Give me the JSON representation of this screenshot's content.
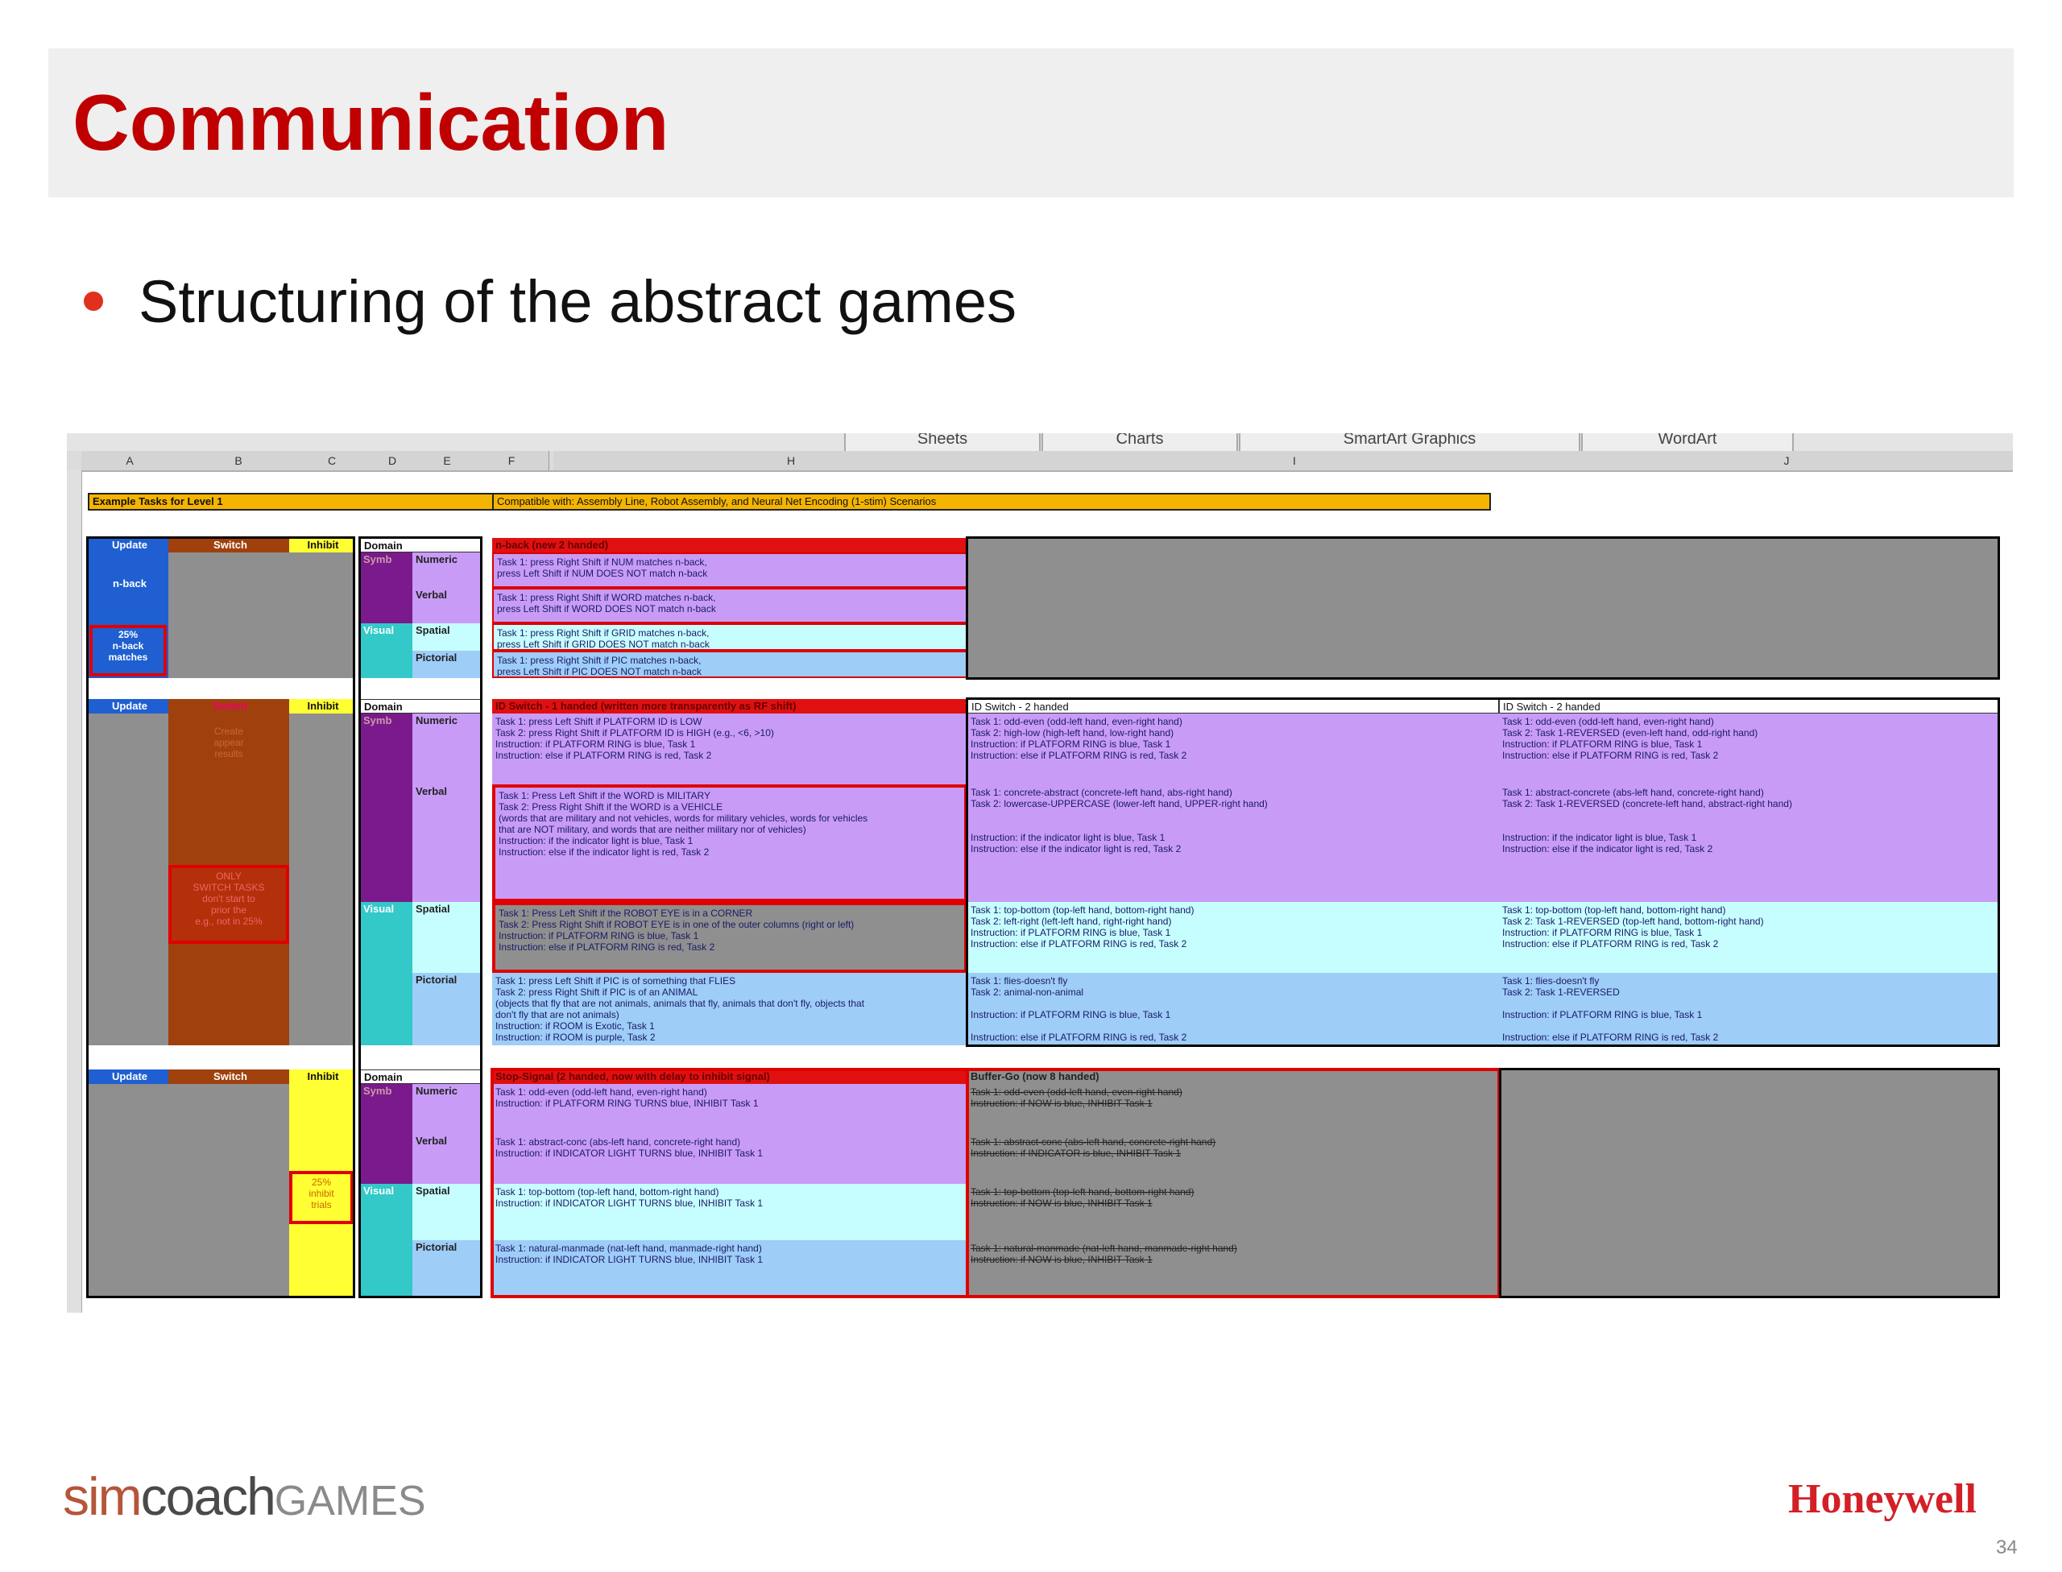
{
  "slide": {
    "title": "Communication",
    "bullet": "Structuring of the abstract games",
    "page_number": "34"
  },
  "logos": {
    "left": {
      "sim": "sim",
      "coach": "coach",
      "games": "GAMES"
    },
    "right": "Honeywell"
  },
  "sheet": {
    "ribbon_tabs": [
      "Sheets",
      "Charts",
      "SmartArt Graphics",
      "WordArt"
    ],
    "columns": [
      "A",
      "B",
      "C",
      "D",
      "E",
      "F",
      "H",
      "I",
      "J"
    ],
    "left_header": "Example Tasks for Level 1",
    "right_header": "Compatible with: Assembly Line, Robot Assembly, and Neural Net Encoding (1-stim) Scenarios",
    "col_labels": {
      "update": "Update",
      "switch": "Switch",
      "inhibit": "Inhibit",
      "domain": "Domain"
    },
    "domains": {
      "verbal_group": "Symb",
      "visual_group": "Visual",
      "numeric": "Numeric",
      "verbal": "Verbal",
      "spatial": "Spatial",
      "pictorial": "Pictorial"
    },
    "block1": {
      "update_label": "n-back",
      "update_note": "25%\nn-back\nmatches",
      "title": "n-back (new 2 handed)",
      "rows": [
        "Task 1: press Right Shift if NUM matches n-back,\n      press Left Shift if NUM DOES NOT match n-back",
        "Task 1: press Right Shift if WORD matches n-back,\n      press Left Shift if WORD DOES NOT match n-back",
        "Task 1: press Right Shift if GRID matches n-back,\n      press Left Shift if GRID DOES NOT match n-back",
        "Task 1: press Right Shift if PIC matches n-back,\n      press Left Shift if PIC DOES NOT match n-back"
      ]
    },
    "block2": {
      "switch_note": "Create\nappear\nresults",
      "switch_note2": "ONLY\nSWITCH TASKS\ndon't start to\nprior the\ne.g., not in 25%",
      "title": "ID Switch - 1 handed (written more transparently as RF shift)",
      "title_mid": "ID Switch - 2 handed",
      "title_right": "ID Switch - 2 handed",
      "rows_left": [
        "Task 1: press Left Shift if PLATFORM ID is LOW\nTask 2: press Right Shift if PLATFORM ID is HIGH        (e.g., <6, >10)\nInstruction: if PLATFORM RING is blue, Task 1\nInstruction: else if PLATFORM RING is red, Task 2",
        "Task 1: Press Left Shift if the WORD is MILITARY\nTask 2: Press Right Shift if the WORD is a VEHICLE\n(words that are military and not vehicles, words for military vehicles, words for vehicles\nthat are NOT military, and words that are neither military nor of vehicles)\nInstruction: if the indicator light is blue, Task 1\nInstruction: else if the indicator light is red, Task 2",
        "Task 1: Press Left Shift if the ROBOT EYE is in a CORNER\nTask 2: Press Right Shift if ROBOT EYE is in one of the outer columns (right or left)\nInstruction: if PLATFORM RING is blue, Task 1\nInstruction: else if PLATFORM RING is red, Task 2",
        "Task 1: press Left Shift if PIC is of something that FLIES\nTask 2: press Right Shift if PIC is of an ANIMAL\n(objects that fly that are not animals, animals that fly, animals that don't fly, objects that\ndon't fly that are not animals)\nInstruction: if ROOM is Exotic, Task 1\nInstruction: if ROOM is purple, Task 2"
      ],
      "rows_mid": [
        "Task 1: odd-even (odd-left hand, even-right hand)\nTask 2: high-low (high-left hand, low-right hand)\nInstruction: if PLATFORM RING is blue, Task 1\nInstruction: else if PLATFORM RING is red, Task 2",
        "Task 1: concrete-abstract (concrete-left hand, abs-right hand)\nTask 2: lowercase-UPPERCASE (lower-left hand, UPPER-right hand)\n\n\nInstruction: if the indicator light is blue, Task 1\nInstruction: else if the indicator light is red, Task 2",
        "Task 1: top-bottom (top-left hand, bottom-right hand)\nTask 2: left-right (left-left hand, right-right hand)\nInstruction: if PLATFORM RING is blue, Task 1\nInstruction: else if PLATFORM RING is red, Task 2",
        "Task 1: flies-doesn't fly\nTask 2: animal-non-animal\n\nInstruction: if PLATFORM RING is blue, Task 1\n\nInstruction: else if PLATFORM RING is red, Task 2"
      ],
      "rows_right": [
        "Task 1: odd-even (odd-left hand, even-right hand)\nTask 2: Task 1-REVERSED (even-left hand, odd-right hand)\nInstruction: if PLATFORM RING is blue, Task 1\nInstruction: else if PLATFORM RING is red, Task 2",
        "Task 1: abstract-concrete (abs-left hand, concrete-right hand)\nTask 2: Task 1-REVERSED (concrete-left hand, abstract-right hand)\n\n\nInstruction: if the indicator light is blue, Task 1\nInstruction: else if the indicator light is red, Task 2",
        "Task 1: top-bottom (top-left hand, bottom-right hand)\nTask 2: Task 1-REVERSED (top-left hand, bottom-right hand)\nInstruction: if PLATFORM RING is blue, Task 1\nInstruction: else if PLATFORM RING is red, Task 2",
        "Task 1: flies-doesn't fly\nTask 2: Task 1-REVERSED\n\nInstruction: if PLATFORM RING is blue, Task 1\n\nInstruction: else if PLATFORM RING is red, Task 2"
      ]
    },
    "block3": {
      "inhibit_note": "25%\ninhibit\ntrials",
      "title": "Stop-Signal (2 handed, now with delay to inhibit signal)",
      "title_mid": "Buffer-Go (now 8 handed)",
      "rows_left": [
        "Task 1: odd-even (odd-left hand, even-right hand)\nInstruction: if PLATFORM RING TURNS blue, INHIBIT Task 1",
        "Task 1: abstract-conc (abs-left hand, concrete-right hand)\nInstruction: if INDICATOR LIGHT TURNS blue, INHIBIT Task 1",
        "Task 1: top-bottom (top-left hand, bottom-right hand)\nInstruction: if INDICATOR LIGHT TURNS blue, INHIBIT Task 1",
        "Task 1: natural-manmade (nat-left hand, manmade-right hand)\nInstruction: if INDICATOR LIGHT TURNS blue, INHIBIT Task 1"
      ],
      "rows_mid": [
        "Task 1: odd-even (odd-left hand, even-right hand)\nInstruction: if NOW is blue, INHIBIT Task 1",
        "Task 1: abstract-conc (abs-left hand, concrete-right hand)\nInstruction: if INDICATOR is blue, INHIBIT Task 1",
        "Task 1: top-bottom (top-left hand, bottom-right hand)\nInstruction: if NOW is blue, INHIBIT Task 1",
        "Task 1: natural-manmade (nat-left hand, manmade-right hand)\nInstruction: if NOW is blue, INHIBIT Task 1"
      ]
    }
  },
  "colors": {
    "title": "#c00000",
    "orange_header": "#f5b400",
    "update_blue": "#1f5fd1",
    "switch_brown": "#a0410d",
    "inhibit_yellow": "#ffff33",
    "purple_cell": "#c89cf6",
    "cyan_cell": "#c6feff",
    "blue_cell": "#9ecdf8",
    "grey_cell": "#8f8f8f",
    "dark_purple": "#7a1a8c",
    "teal": "#33c9c9",
    "red_header": "#e01010"
  }
}
